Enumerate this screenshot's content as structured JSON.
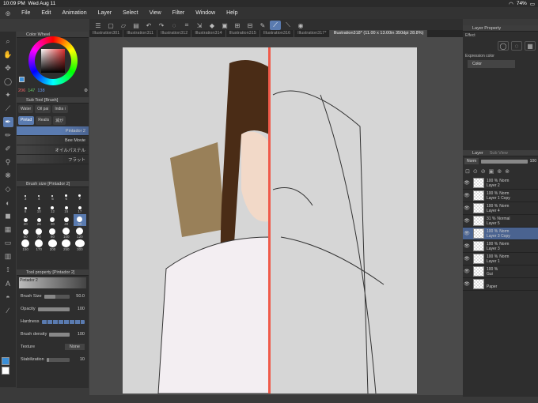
{
  "status": {
    "time": "10:09 PM",
    "date": "Wed Aug 11",
    "battery": "74%"
  },
  "menu": [
    "File",
    "Edit",
    "Animation",
    "Layer",
    "Select",
    "View",
    "Filter",
    "Window",
    "Help"
  ],
  "tabs": [
    "Illustration301",
    "Illustration311",
    "Illustration312",
    "Illustration314",
    "Illustration315",
    "Illustration316",
    "Illustration317*",
    "Illustration318* (11.00 x 13.00in 350dpi 28.8%)"
  ],
  "color_wheel": {
    "title": "Color Wheel",
    "r": "206",
    "g": "147",
    "b": "138"
  },
  "subtool": {
    "title": "Sub Tool [Brush]",
    "row1": [
      "Water",
      "Oil pai",
      "India i"
    ],
    "row2": [
      "Pintad",
      "Realis",
      "滅が"
    ]
  },
  "brushes": [
    "Pintador 2",
    "Bee Movie",
    "オイルパステル",
    "フラット"
  ],
  "brush_size": {
    "title": "Brush size [Pintador 2]",
    "sizes": [
      "3",
      "4",
      "5",
      "6",
      "7",
      "8",
      "10",
      "12",
      "15",
      "17",
      "20",
      "25",
      "30",
      "40",
      "50",
      "60",
      "70",
      "80",
      "100",
      "120",
      "150",
      "170",
      "200",
      "250",
      "300"
    ],
    "active": "50"
  },
  "tool_property": {
    "title": "Tool property [Pintador 2]",
    "brush_name": "Pintador 2",
    "brush_size_label": "Brush Size",
    "brush_size": "50.0",
    "opacity_label": "Opacity",
    "opacity": "100",
    "hardness_label": "Hardness",
    "density_label": "Brush density",
    "density": "100",
    "texture_label": "Texture",
    "texture": "None",
    "stabilization_label": "Stabilization",
    "stabilization": "10"
  },
  "layer_property": {
    "title": "Layer Property",
    "effect_label": "Effect",
    "expression_label": "Expression color",
    "expression_value": "Color"
  },
  "layers_panel": {
    "tab1": "Layer",
    "tab2": "Sub View",
    "blend": "Norm",
    "opacity": "100"
  },
  "layers": [
    {
      "pct": "100 %",
      "mode": "Norm",
      "name": "Layer 2"
    },
    {
      "pct": "100 %",
      "mode": "Norm",
      "name": "Layer 1 Copy"
    },
    {
      "pct": "100 %",
      "mode": "Norm",
      "name": "Layer 4"
    },
    {
      "pct": "31 %",
      "mode": "Normal",
      "name": "Layer 5"
    },
    {
      "pct": "100 %",
      "mode": "Norm",
      "name": "Layer 3 Copy"
    },
    {
      "pct": "100 %",
      "mode": "Norm",
      "name": "Layer 3"
    },
    {
      "pct": "100 %",
      "mode": "Norm",
      "name": "Layer 1"
    },
    {
      "pct": "100 %",
      "mode": "",
      "name": "Gui"
    },
    {
      "pct": "",
      "mode": "",
      "name": "Paper"
    }
  ],
  "accent": "#5a7bb0"
}
